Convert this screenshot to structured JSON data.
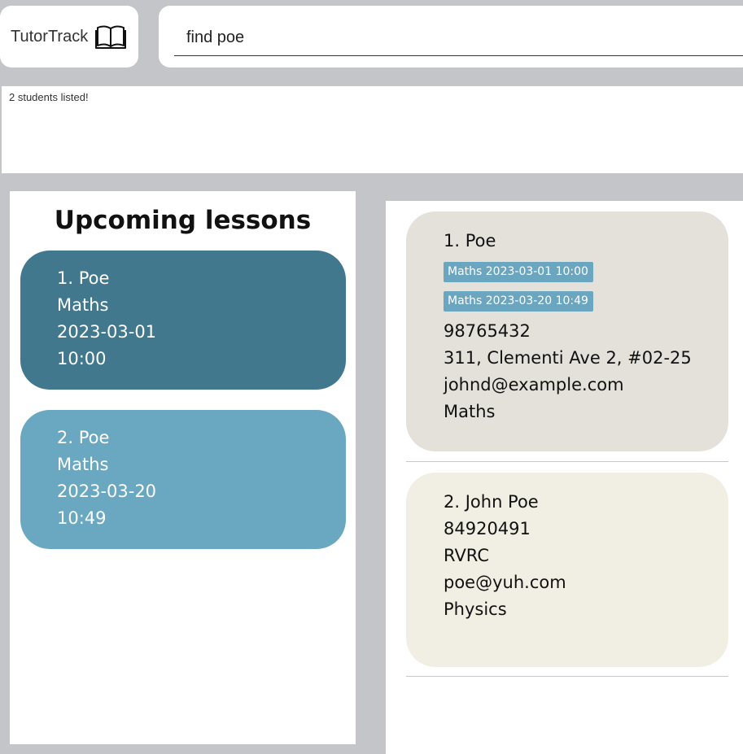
{
  "app": {
    "name": "TutorTrack",
    "logo_icon": "open-book-icon"
  },
  "command": {
    "value": "find poe"
  },
  "result": {
    "message": "2 students listed!"
  },
  "lessons": {
    "title": "Upcoming lessons",
    "items": [
      {
        "index": "1.  Poe",
        "subject": "Maths",
        "date": "2023-03-01",
        "time": "10:00",
        "color": "#41788d"
      },
      {
        "index": "2.  Poe",
        "subject": "Maths",
        "date": "2023-03-20",
        "time": "10:49",
        "color": "#6aa8c1"
      }
    ]
  },
  "students": {
    "items": [
      {
        "header": "1.  Poe",
        "tags": [
          "Maths  2023-03-01  10:00",
          "Maths  2023-03-20  10:49"
        ],
        "phone": "98765432",
        "address": "311, Clementi Ave 2, #02-25",
        "email": "johnd@example.com",
        "subject": "Maths",
        "color": "#e4e1db"
      },
      {
        "header": "2.  John Poe",
        "tags": [],
        "phone": "84920491",
        "address": "RVRC",
        "email": "poe@yuh.com",
        "subject": "Physics",
        "color": "#f1eee3"
      }
    ]
  },
  "colors": {
    "background": "#c4c5c9",
    "tag": "#6aa6c0"
  }
}
